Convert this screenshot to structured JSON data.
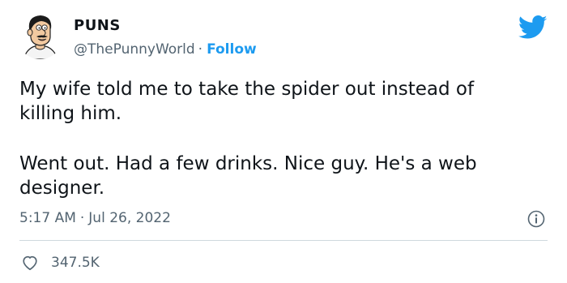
{
  "author": {
    "display_name": "PUNS",
    "handle": "@ThePunnyWorld",
    "separator": "·",
    "follow_label": "Follow"
  },
  "tweet": {
    "lines": [
      "My wife told me to take the spider out instead of",
      "killing him.",
      "Went out. Had a few drinks. Nice guy. He's a web",
      "designer."
    ]
  },
  "meta": {
    "time": "5:17 AM",
    "separator": "·",
    "date": "Jul 26, 2022"
  },
  "engagement": {
    "likes": "347.5K"
  },
  "icons": {
    "brand": "twitter-bird-icon",
    "info": "info-icon",
    "like": "heart-icon"
  },
  "colors": {
    "brand_blue": "#1d9bf0",
    "text_primary": "#0f1419",
    "text_secondary": "#536471",
    "divider": "#cfd9de"
  }
}
